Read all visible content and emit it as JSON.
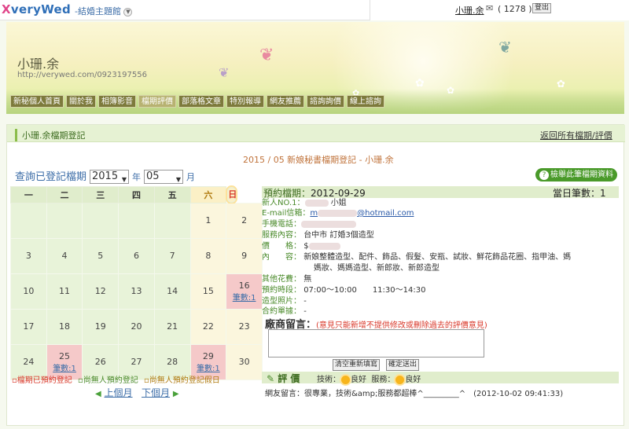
{
  "topbar": {
    "logo_x": "X",
    "logo_text": "veryWed",
    "site_menu": "-結婚主題館",
    "user_name": "小珊.余",
    "mail_count": "( 1278 )",
    "logout": "登出"
  },
  "banner": {
    "name": "小珊.余",
    "url": "http://verywed.com/0923197556"
  },
  "nav": [
    "新秘個人首頁",
    "關於我",
    "相簿影音",
    "檔期評價",
    "部落格文章",
    "特別報導",
    "網友推薦",
    "諮詢詢價",
    "線上諮詢"
  ],
  "nav_active_index": 3,
  "panel": {
    "title": "小珊.余檔期登記",
    "back_link": "返回所有檔期/評價",
    "calendar_title": "2015 / 05 新娘秘書檔期登記 - 小珊.余",
    "query_label": "查詢已登記檔期",
    "year": "2015",
    "year_unit": "年",
    "month": "05",
    "month_unit": "月",
    "print_btn": "檢舉此筆檔期資料"
  },
  "calendar": {
    "weekdays": [
      "一",
      "二",
      "三",
      "四",
      "五",
      "六",
      "日"
    ],
    "booked_label": "筆數:1",
    "rows": [
      [
        "",
        "",
        "",
        "",
        "",
        "1",
        "2"
      ],
      [
        "3",
        "4",
        "5",
        "6",
        "7",
        "8",
        "9"
      ],
      [
        "10",
        "11",
        "12",
        "13",
        "14",
        "15",
        "16"
      ],
      [
        "17",
        "18",
        "19",
        "20",
        "21",
        "22",
        "23"
      ],
      [
        "24",
        "25",
        "26",
        "27",
        "28",
        "29",
        "30"
      ]
    ],
    "booked_days": [
      "16",
      "25",
      "29"
    ]
  },
  "legend": {
    "booked": "▫檔期已預約登記",
    "free": "▫尚無人預約登記",
    "free_holiday": "▫尚無人預約登記假日"
  },
  "month_nav": {
    "prev": "上個月",
    "next": "下個月"
  },
  "detail": {
    "booking_label": "預約檔期：",
    "booking_date": "2012-09-29",
    "day_count_label": "當日筆數：",
    "day_count": "1",
    "bride_label": "新人NO.1：",
    "bride_suffix": "小姐",
    "email_label": "E-mail信箱：",
    "email_prefix": "m",
    "email_domain": "@hotmail.com",
    "phone_label": "手機電話：",
    "service_label": "服務內容：",
    "service_value": "台中市 訂婚3個造型",
    "price_label": "價　　格：",
    "price_prefix": "$",
    "content_label": "內　　容：",
    "content_line1": "新娘整體造型、配件、飾品、假髮、安瓶、試妝、鮮花飾品花圈、指甲油、媽",
    "content_line2": "媽妝、媽媽造型、新郎妝、新郎造型",
    "other_label": "其他花費：",
    "other_value": "無",
    "time_label": "預約時段：",
    "time_value": "07:00～10:00　　11:30～14:30",
    "photo_label": "造型照片：",
    "photo_value": "-",
    "contract_label": "合約單據：",
    "contract_value": "-",
    "vendor_msg_label": "廠商留言：",
    "vendor_msg_warn": "(意見只能新增不提供修改或刪除過去的評價意見)",
    "clear_btn": "清空重新填寫",
    "submit_btn": "確定送出",
    "eval_label": "評 價",
    "eval_skill_label": "技術：",
    "eval_skill": "良好",
    "eval_service_label": "服務：",
    "eval_service": "良好",
    "comment": "網友留言：很專業，技術&amp;服務都超棒^_________^　(2012-10-02 09:41:33)"
  },
  "colors": {
    "accent_green": "#4a9a2a",
    "booked_pink": "#f5c9c9",
    "link_blue": "#3d6ea8"
  }
}
